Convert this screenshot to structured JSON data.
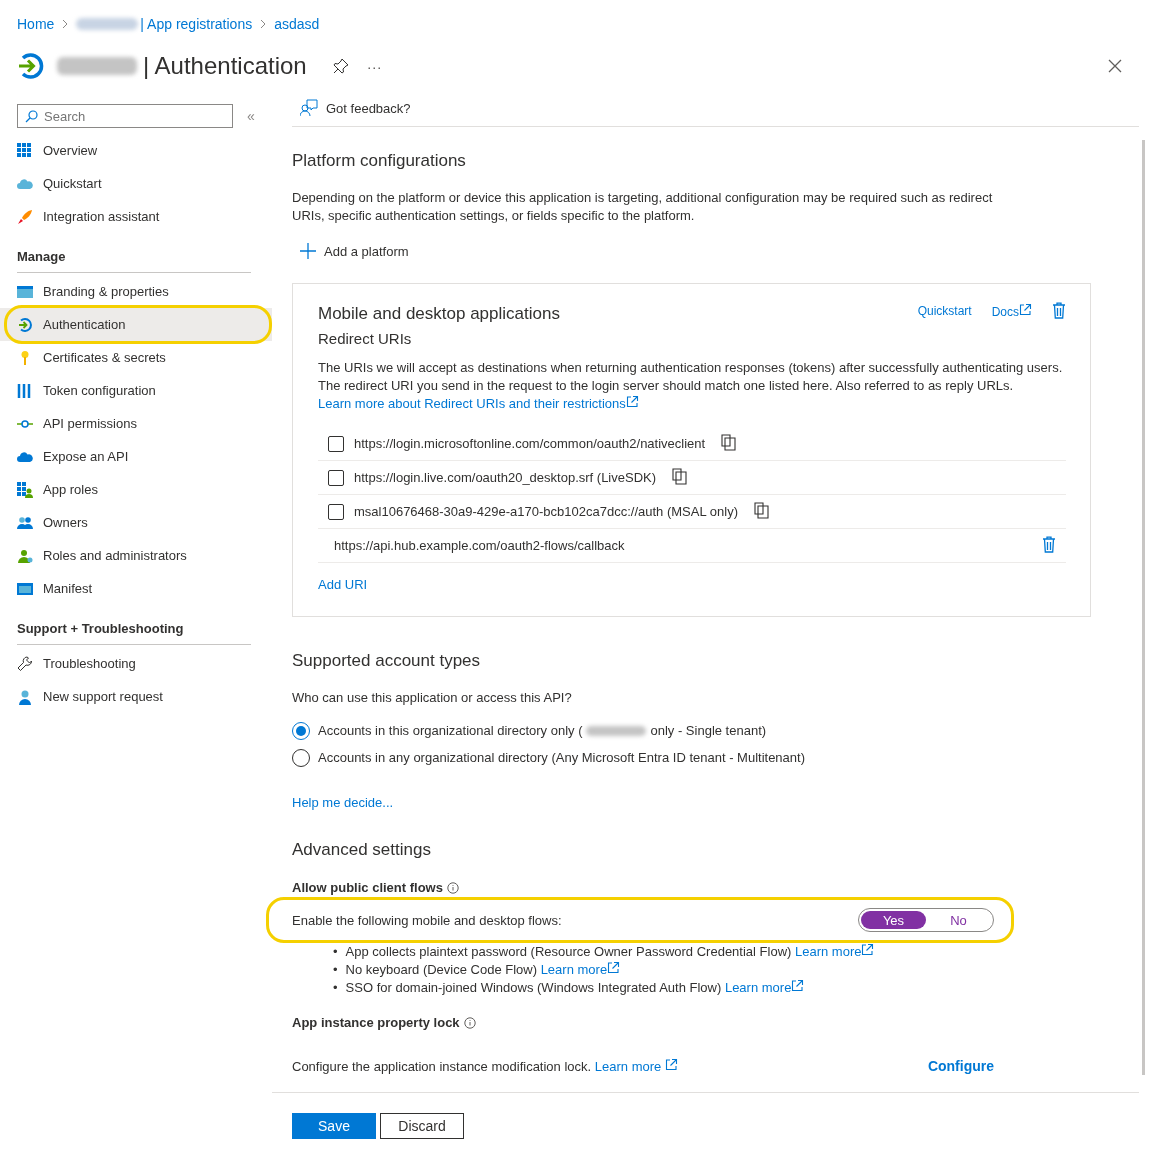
{
  "breadcrumb": [
    {
      "label": "Home",
      "redacted_prefix": false
    },
    {
      "label": "| App registrations",
      "redacted_prefix": true
    },
    {
      "label": "asdasd",
      "redacted_prefix": false
    }
  ],
  "header": {
    "title": "| Authentication",
    "redacted_prefix": true,
    "more": "···"
  },
  "sidebar": {
    "search": {
      "placeholder": "Search"
    },
    "collapse": "«",
    "sections": [
      {
        "items": [
          {
            "label": "Overview",
            "selected": false,
            "highlighted": false
          },
          {
            "label": "Quickstart",
            "selected": false,
            "highlighted": false
          },
          {
            "label": "Integration assistant",
            "selected": false,
            "highlighted": false
          }
        ]
      },
      {
        "heading": "Manage",
        "items": [
          {
            "label": "Branding & properties",
            "selected": false,
            "highlighted": false
          },
          {
            "label": "Authentication",
            "selected": true,
            "highlighted": true
          },
          {
            "label": "Certificates & secrets",
            "selected": false,
            "highlighted": false
          },
          {
            "label": "Token configuration",
            "selected": false,
            "highlighted": false
          },
          {
            "label": "API permissions",
            "selected": false,
            "highlighted": false
          },
          {
            "label": "Expose an API",
            "selected": false,
            "highlighted": false
          },
          {
            "label": "App roles",
            "selected": false,
            "highlighted": false
          },
          {
            "label": "Owners",
            "selected": false,
            "highlighted": false
          },
          {
            "label": "Roles and administrators",
            "selected": false,
            "highlighted": false
          },
          {
            "label": "Manifest",
            "selected": false,
            "highlighted": false
          }
        ]
      },
      {
        "heading": "Support + Troubleshooting",
        "items": [
          {
            "label": "Troubleshooting",
            "selected": false,
            "highlighted": false
          },
          {
            "label": "New support request",
            "selected": false,
            "highlighted": false
          }
        ]
      }
    ]
  },
  "feedback": "Got feedback?",
  "platform": {
    "title": "Platform configurations",
    "description": "Depending on the platform or device this application is targeting, additional configuration may be required such as redirect URIs, specific authentication settings, or fields specific to the platform.",
    "add_button": "Add a platform"
  },
  "platform_card": {
    "title": "Mobile and desktop applications",
    "links": [
      {
        "label": "Quickstart",
        "external": false
      },
      {
        "label": "Docs",
        "external": true
      }
    ],
    "subtitle": "Redirect URIs",
    "description": "The URIs we will accept as destinations when returning authentication responses (tokens) after successfully authenticating users. The redirect URI you send in the request to the login server should match one listed here. Also referred to as reply URLs. ",
    "description_link": "Learn more about Redirect URIs and their restrictions",
    "uris": [
      {
        "kind": "suggested",
        "uri": "https://login.microsoftonline.com/common/oauth2/nativeclient",
        "checked": false
      },
      {
        "kind": "suggested",
        "uri": "https://login.live.com/oauth20_desktop.srf (LiveSDK)",
        "checked": false
      },
      {
        "kind": "suggested",
        "uri": "msal10676468-30a9-429e-a170-bcb102ca7dcc://auth (MSAL only)",
        "checked": false
      },
      {
        "kind": "custom",
        "uri": "https://api.hub.example.com/oauth2-flows/callback"
      }
    ],
    "add_uri": "Add URI"
  },
  "account_types": {
    "title": "Supported account types",
    "question": "Who can use this application or access this API?",
    "options": [
      {
        "label": "Accounts in this organizational directory only (",
        "redacted": true,
        "label_after": "only - Single tenant)",
        "selected": true
      },
      {
        "label": "Accounts in any organizational directory (Any Microsoft Entra ID tenant - Multitenant)",
        "redacted": false,
        "selected": false
      }
    ],
    "help": "Help me decide..."
  },
  "advanced": {
    "title": "Advanced settings",
    "public_client": {
      "label": "Allow public client flows",
      "prompt": "Enable the following mobile and desktop flows:",
      "highlighted": true,
      "toggle": [
        {
          "label": "Yes",
          "selected": true
        },
        {
          "label": "No",
          "selected": false
        }
      ],
      "flows": [
        {
          "bullet": "•",
          "text": "App collects plaintext password (Resource Owner Password Credential Flow) ",
          "link": "Learn more"
        },
        {
          "bullet": "•",
          "text": "No keyboard (Device Code Flow) ",
          "link": "Learn more"
        },
        {
          "bullet": "•",
          "text": "SSO for domain-joined Windows (Windows Integrated Auth Flow) ",
          "link": "Learn more"
        }
      ]
    },
    "lock": {
      "label": "App instance property lock",
      "description": "Configure the application instance modification lock. ",
      "link": "Learn more",
      "action": "Configure"
    }
  },
  "footer": {
    "buttons": [
      {
        "label": "Save",
        "kind": "primary"
      },
      {
        "label": "Discard",
        "kind": "secondary"
      }
    ]
  }
}
